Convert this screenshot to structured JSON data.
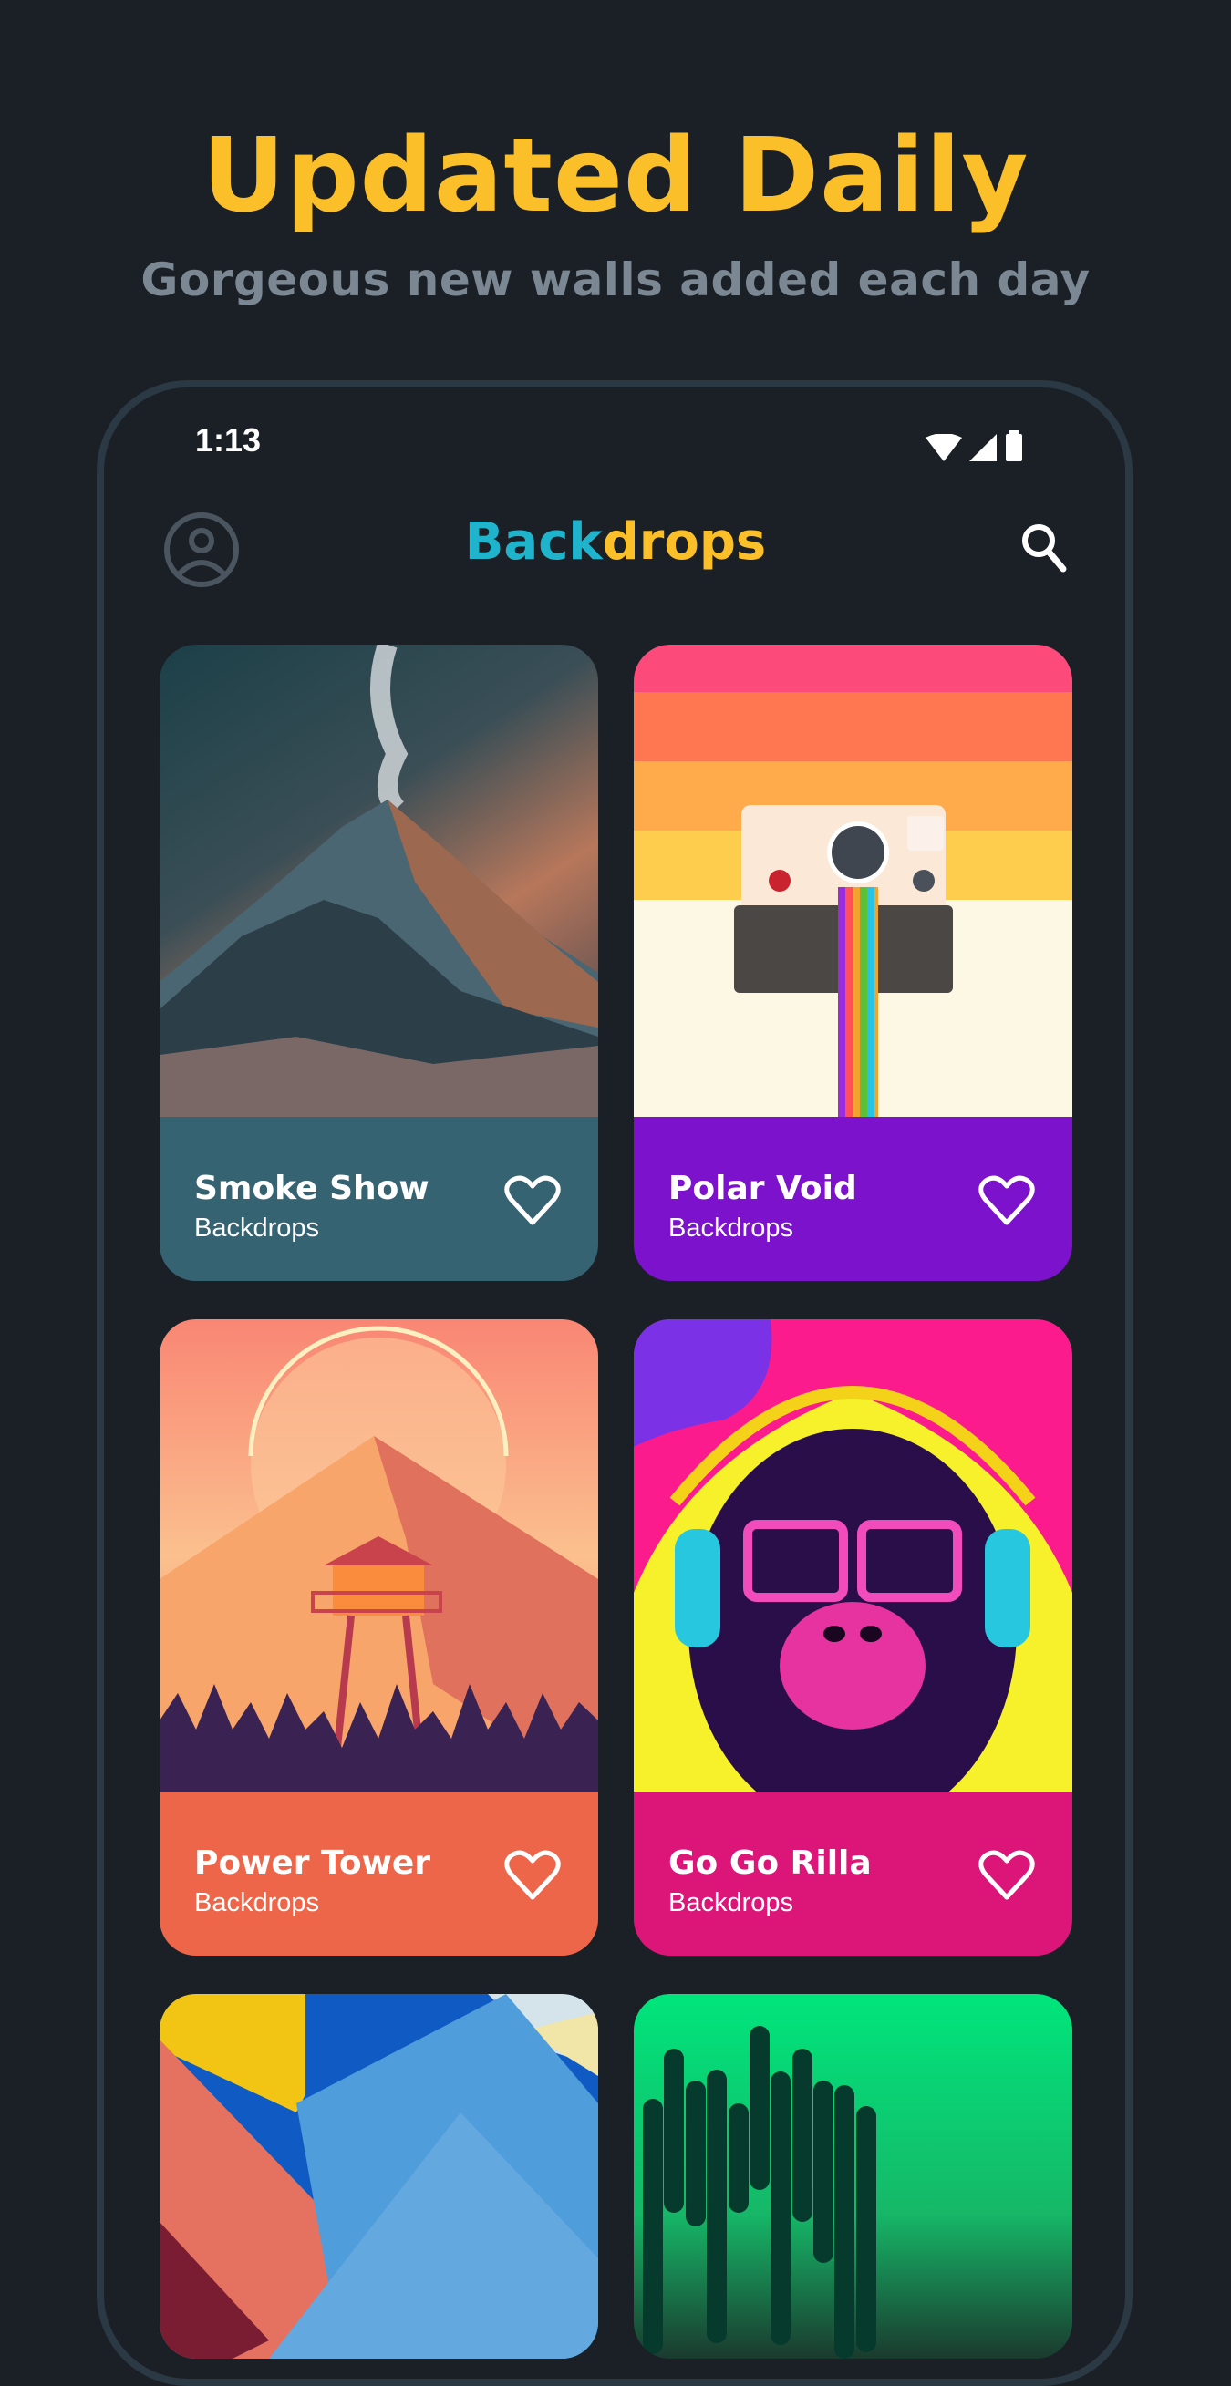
{
  "promo": {
    "title": "Updated Daily",
    "subtitle": "Gorgeous new walls added each day"
  },
  "status_bar": {
    "time": "1:13",
    "icons": [
      "wifi-icon",
      "signal-icon",
      "battery-icon"
    ]
  },
  "app_bar": {
    "title_part1": "Back",
    "title_part2": "drops",
    "title_color1": "#1fb4cc",
    "title_color2": "#fbbf2a",
    "left_icon": "profile-icon",
    "right_icon": "search-icon"
  },
  "wallpapers": [
    {
      "title": "Smoke Show",
      "subtitle": "Backdrops",
      "footer_color": "#366372",
      "favorite": false
    },
    {
      "title": "Polar Void",
      "subtitle": "Backdrops",
      "footer_color": "#7c12cc",
      "favorite": false
    },
    {
      "title": "Power Tower",
      "subtitle": "Backdrops",
      "footer_color": "#ee6649",
      "favorite": false
    },
    {
      "title": "Go Go Rilla",
      "subtitle": "Backdrops",
      "footer_color": "#dc1679",
      "favorite": false
    },
    {
      "title": "",
      "subtitle": "",
      "footer_color": "",
      "favorite": false
    },
    {
      "title": "",
      "subtitle": "",
      "footer_color": "",
      "favorite": false
    }
  ],
  "colors": {
    "background": "#1b2027",
    "accent_yellow": "#fbbf2a",
    "accent_cyan": "#1fb4cc",
    "subtitle_gray": "#7b8894",
    "frame": "#2b3945"
  }
}
